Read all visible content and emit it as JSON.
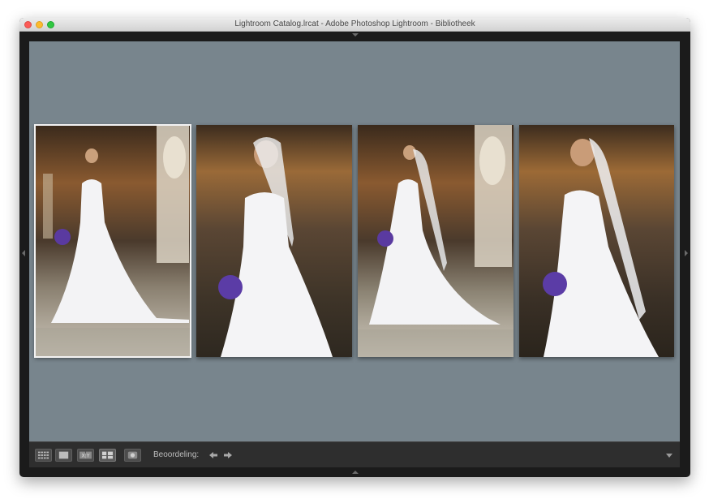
{
  "window": {
    "title": "Lightroom Catalog.lrcat - Adobe Photoshop Lightroom - Bibliotheek"
  },
  "survey": {
    "selected_index": 0,
    "photos": [
      {
        "name": "bride-photo-1",
        "selected": true
      },
      {
        "name": "bride-photo-2",
        "selected": false
      },
      {
        "name": "bride-photo-3",
        "selected": false
      },
      {
        "name": "bride-photo-4",
        "selected": false
      }
    ]
  },
  "toolbar": {
    "view_buttons": [
      "grid-view-icon",
      "loupe-view-icon",
      "compare-view-icon",
      "survey-view-icon",
      "people-view-icon"
    ],
    "compare_label": "X|Y",
    "rating_label": "Beoordeling:",
    "nav_icons": [
      "arrow-left-icon",
      "arrow-right-icon"
    ],
    "menu_icon": "chevron-down-icon"
  },
  "colors": {
    "background_gray": "#78858d",
    "selection_border": "#f2f2f2",
    "toolbar_bg": "#2e2e2e"
  }
}
